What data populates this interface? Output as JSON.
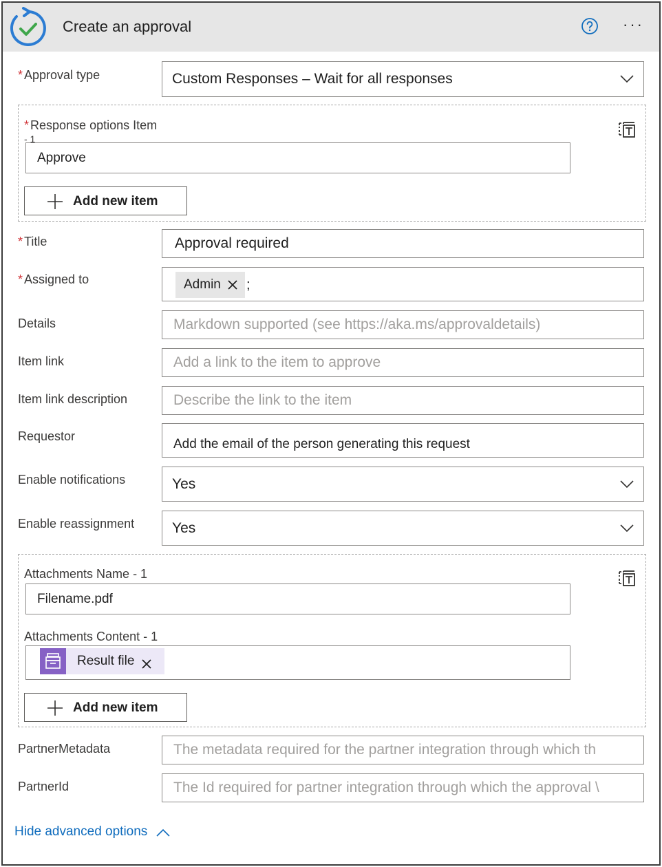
{
  "header": {
    "title": "Create an approval",
    "icons": [
      "approval-refresh-check-icon",
      "help-icon",
      "more-icon"
    ],
    "more_label": "···"
  },
  "approval_type": {
    "label": "Approval type",
    "required_mark": "*",
    "value": "Custom Responses – Wait for all responses"
  },
  "response_options": {
    "label": "Response options Item",
    "index_label": "- 1",
    "required_mark": "*",
    "value": "Approve",
    "add_button_label": "Add new item"
  },
  "title_field": {
    "label": "Title",
    "required_mark": "*",
    "value": "Approval required"
  },
  "assigned_to": {
    "label": "Assigned to",
    "required_mark": "*",
    "token": "Admin",
    "separator": ";"
  },
  "details": {
    "label": "Details",
    "placeholder": "Markdown supported (see https://aka.ms/approvaldetails)"
  },
  "item_link": {
    "label": "Item link",
    "placeholder": "Add a link to the item to approve"
  },
  "item_link_description": {
    "label": "Item link description",
    "placeholder": "Describe the link to the item"
  },
  "requestor": {
    "label": "Requestor",
    "value": "Add the email of the person generating this request"
  },
  "enable_notifications": {
    "label": "Enable notifications",
    "value": "Yes"
  },
  "enable_reassignment": {
    "label": "Enable reassignment",
    "value": "Yes"
  },
  "attachments": {
    "name_label": "Attachments Name - 1",
    "name_value": "Filename.pdf",
    "content_label": "Attachments Content - 1",
    "content_token": "Result file",
    "add_button_label": "Add new item"
  },
  "partner_metadata": {
    "label": "PartnerMetadata",
    "placeholder": "The metadata required for the partner integration through which th"
  },
  "partner_id": {
    "label": "PartnerId",
    "placeholder": "The Id required for partner integration through which the approval \\"
  },
  "footer": {
    "hide_advanced_label": "Hide advanced options"
  },
  "colors": {
    "accent": "#0f6cbd",
    "required": "#d13438",
    "header_bg": "#e6e6e6",
    "token_purple": "#8661c5"
  }
}
